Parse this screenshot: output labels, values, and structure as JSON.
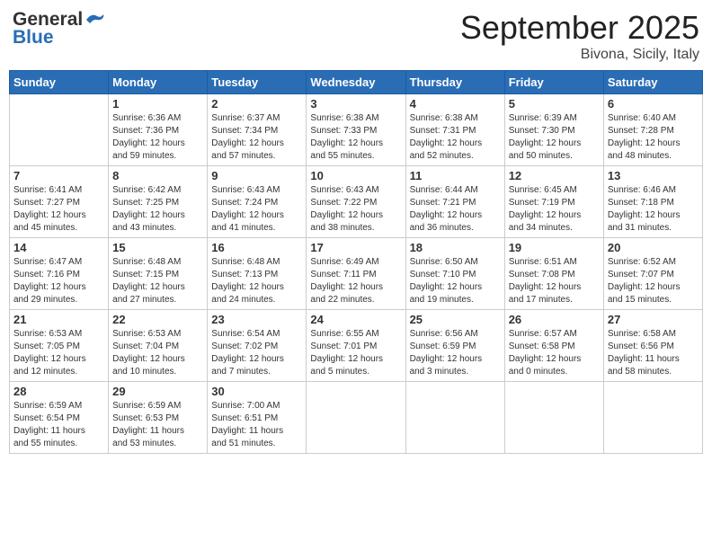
{
  "header": {
    "logo_line1": "General",
    "logo_line2": "Blue",
    "month": "September 2025",
    "location": "Bivona, Sicily, Italy"
  },
  "days_of_week": [
    "Sunday",
    "Monday",
    "Tuesday",
    "Wednesday",
    "Thursday",
    "Friday",
    "Saturday"
  ],
  "weeks": [
    [
      {
        "day": "",
        "info": ""
      },
      {
        "day": "1",
        "info": "Sunrise: 6:36 AM\nSunset: 7:36 PM\nDaylight: 12 hours\nand 59 minutes."
      },
      {
        "day": "2",
        "info": "Sunrise: 6:37 AM\nSunset: 7:34 PM\nDaylight: 12 hours\nand 57 minutes."
      },
      {
        "day": "3",
        "info": "Sunrise: 6:38 AM\nSunset: 7:33 PM\nDaylight: 12 hours\nand 55 minutes."
      },
      {
        "day": "4",
        "info": "Sunrise: 6:38 AM\nSunset: 7:31 PM\nDaylight: 12 hours\nand 52 minutes."
      },
      {
        "day": "5",
        "info": "Sunrise: 6:39 AM\nSunset: 7:30 PM\nDaylight: 12 hours\nand 50 minutes."
      },
      {
        "day": "6",
        "info": "Sunrise: 6:40 AM\nSunset: 7:28 PM\nDaylight: 12 hours\nand 48 minutes."
      }
    ],
    [
      {
        "day": "7",
        "info": "Sunrise: 6:41 AM\nSunset: 7:27 PM\nDaylight: 12 hours\nand 45 minutes."
      },
      {
        "day": "8",
        "info": "Sunrise: 6:42 AM\nSunset: 7:25 PM\nDaylight: 12 hours\nand 43 minutes."
      },
      {
        "day": "9",
        "info": "Sunrise: 6:43 AM\nSunset: 7:24 PM\nDaylight: 12 hours\nand 41 minutes."
      },
      {
        "day": "10",
        "info": "Sunrise: 6:43 AM\nSunset: 7:22 PM\nDaylight: 12 hours\nand 38 minutes."
      },
      {
        "day": "11",
        "info": "Sunrise: 6:44 AM\nSunset: 7:21 PM\nDaylight: 12 hours\nand 36 minutes."
      },
      {
        "day": "12",
        "info": "Sunrise: 6:45 AM\nSunset: 7:19 PM\nDaylight: 12 hours\nand 34 minutes."
      },
      {
        "day": "13",
        "info": "Sunrise: 6:46 AM\nSunset: 7:18 PM\nDaylight: 12 hours\nand 31 minutes."
      }
    ],
    [
      {
        "day": "14",
        "info": "Sunrise: 6:47 AM\nSunset: 7:16 PM\nDaylight: 12 hours\nand 29 minutes."
      },
      {
        "day": "15",
        "info": "Sunrise: 6:48 AM\nSunset: 7:15 PM\nDaylight: 12 hours\nand 27 minutes."
      },
      {
        "day": "16",
        "info": "Sunrise: 6:48 AM\nSunset: 7:13 PM\nDaylight: 12 hours\nand 24 minutes."
      },
      {
        "day": "17",
        "info": "Sunrise: 6:49 AM\nSunset: 7:11 PM\nDaylight: 12 hours\nand 22 minutes."
      },
      {
        "day": "18",
        "info": "Sunrise: 6:50 AM\nSunset: 7:10 PM\nDaylight: 12 hours\nand 19 minutes."
      },
      {
        "day": "19",
        "info": "Sunrise: 6:51 AM\nSunset: 7:08 PM\nDaylight: 12 hours\nand 17 minutes."
      },
      {
        "day": "20",
        "info": "Sunrise: 6:52 AM\nSunset: 7:07 PM\nDaylight: 12 hours\nand 15 minutes."
      }
    ],
    [
      {
        "day": "21",
        "info": "Sunrise: 6:53 AM\nSunset: 7:05 PM\nDaylight: 12 hours\nand 12 minutes."
      },
      {
        "day": "22",
        "info": "Sunrise: 6:53 AM\nSunset: 7:04 PM\nDaylight: 12 hours\nand 10 minutes."
      },
      {
        "day": "23",
        "info": "Sunrise: 6:54 AM\nSunset: 7:02 PM\nDaylight: 12 hours\nand 7 minutes."
      },
      {
        "day": "24",
        "info": "Sunrise: 6:55 AM\nSunset: 7:01 PM\nDaylight: 12 hours\nand 5 minutes."
      },
      {
        "day": "25",
        "info": "Sunrise: 6:56 AM\nSunset: 6:59 PM\nDaylight: 12 hours\nand 3 minutes."
      },
      {
        "day": "26",
        "info": "Sunrise: 6:57 AM\nSunset: 6:58 PM\nDaylight: 12 hours\nand 0 minutes."
      },
      {
        "day": "27",
        "info": "Sunrise: 6:58 AM\nSunset: 6:56 PM\nDaylight: 11 hours\nand 58 minutes."
      }
    ],
    [
      {
        "day": "28",
        "info": "Sunrise: 6:59 AM\nSunset: 6:54 PM\nDaylight: 11 hours\nand 55 minutes."
      },
      {
        "day": "29",
        "info": "Sunrise: 6:59 AM\nSunset: 6:53 PM\nDaylight: 11 hours\nand 53 minutes."
      },
      {
        "day": "30",
        "info": "Sunrise: 7:00 AM\nSunset: 6:51 PM\nDaylight: 11 hours\nand 51 minutes."
      },
      {
        "day": "",
        "info": ""
      },
      {
        "day": "",
        "info": ""
      },
      {
        "day": "",
        "info": ""
      },
      {
        "day": "",
        "info": ""
      }
    ]
  ]
}
